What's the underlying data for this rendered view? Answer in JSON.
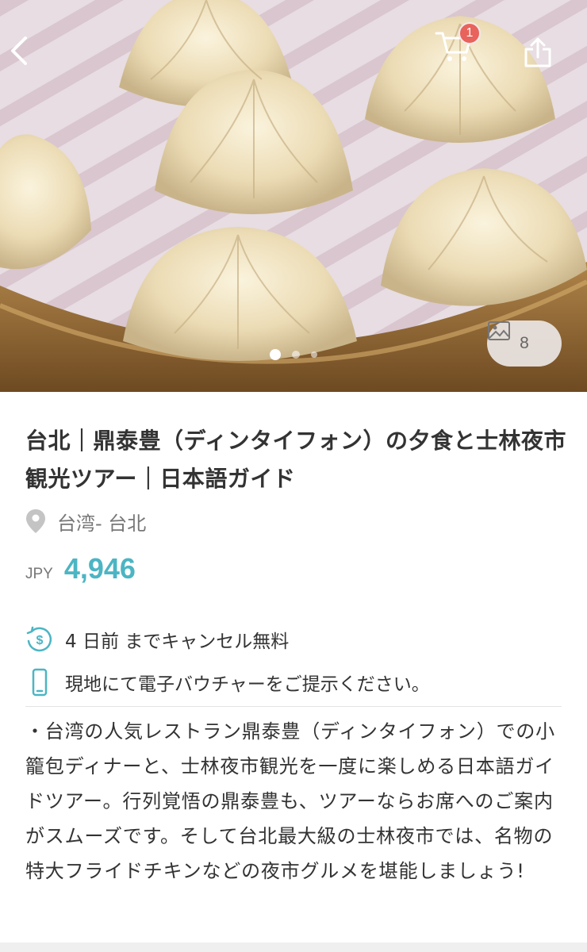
{
  "header": {
    "cart_count": "1",
    "photo_count": "8"
  },
  "carousel": {
    "total": 3,
    "active": 0
  },
  "product": {
    "title": "台北｜鼎泰豊（ディンタイフォン）の夕食と士林夜市観光ツアー｜日本語ガイド",
    "location": "台湾- 台北",
    "currency": "JPY",
    "price": "4,946"
  },
  "features": [
    {
      "icon": "refund-clock-icon",
      "text": "4 日前 までキャンセル無料"
    },
    {
      "icon": "mobile-phone-icon",
      "text": "現地にて電子バウチャーをご提示ください。"
    }
  ],
  "description": "・台湾の人気レストラン鼎泰豊（ディンタイフォン）での小籠包ディナーと、士林夜市観光を一度に楽しめる日本語ガイドツアー。行列覚悟の鼎泰豊も、ツアーならお席へのご案内がスムーズです。そして台北最大級の士林夜市では、名物の特大フライドチキンなどの夜市グルメを堪能しましょう!",
  "colors": {
    "accent": "#4cb5c3",
    "badge": "#e8635b"
  }
}
